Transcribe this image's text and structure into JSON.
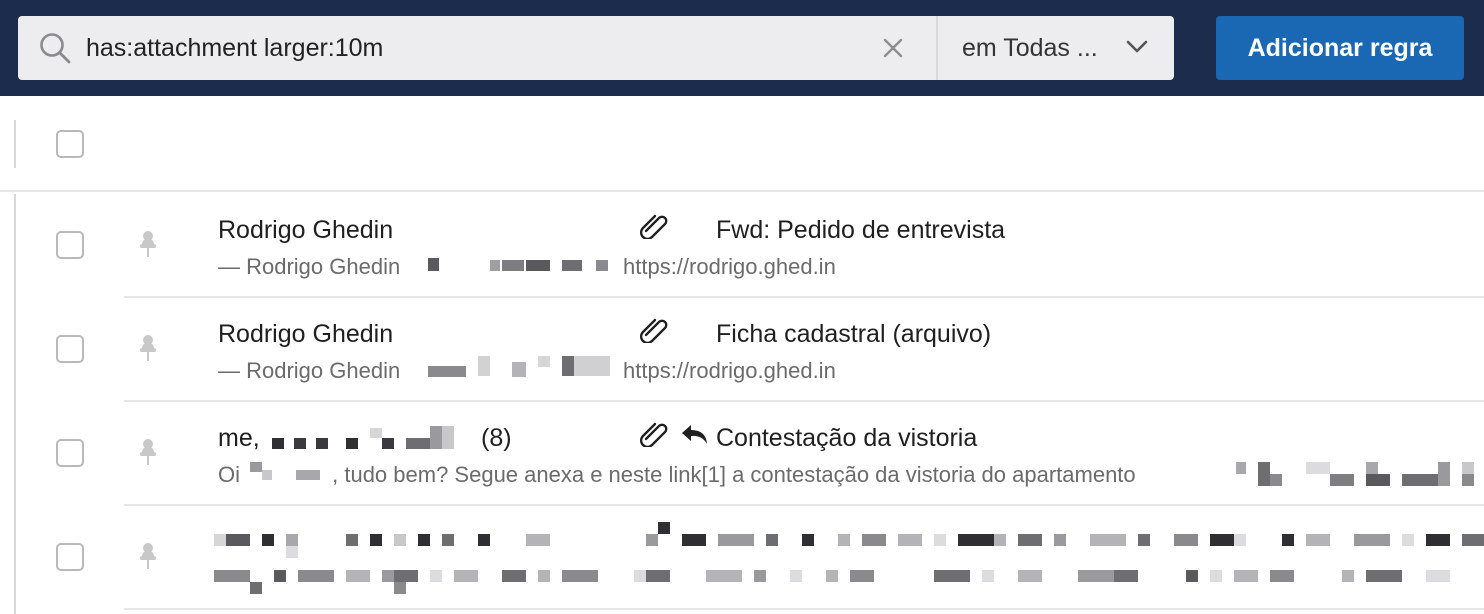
{
  "search": {
    "value": "has:attachment larger:10m",
    "scope_label": "em Todas ..."
  },
  "toolbar": {
    "add_rule_label": "Adicionar regra"
  },
  "messages": [
    {
      "sender": "Rodrigo Ghedin",
      "subject": "Fwd: Pedido de entrevista",
      "snippet": "— Rodrigo Ghedin",
      "link": "https://rodrigo.ghed.in",
      "has_attachment": true,
      "replied": false
    },
    {
      "sender": "Rodrigo Ghedin",
      "subject": "Ficha cadastral (arquivo)",
      "snippet": "— Rodrigo Ghedin",
      "link": "https://rodrigo.ghed.in",
      "has_attachment": true,
      "replied": false
    },
    {
      "sender": "me,",
      "count": "(8)",
      "subject": "Contestação da vistoria",
      "snippet_prefix": "Oi",
      "snippet": ", tudo bem? Segue anexa e neste link[1] a contestação da vistoria do apartamento",
      "has_attachment": true,
      "replied": true
    },
    {
      "sender": "",
      "subject": "",
      "snippet": "",
      "has_attachment": false,
      "replied": false
    }
  ],
  "icons": {
    "search": "search-icon",
    "clear": "close-icon",
    "scope": "chevron-down-icon",
    "pin": "pin-icon",
    "attachment": "paperclip-icon",
    "reply": "reply-icon"
  },
  "colors": {
    "topbar": "#1c2c4d",
    "accent": "#1a67b3",
    "search_bg": "#ededf0"
  }
}
